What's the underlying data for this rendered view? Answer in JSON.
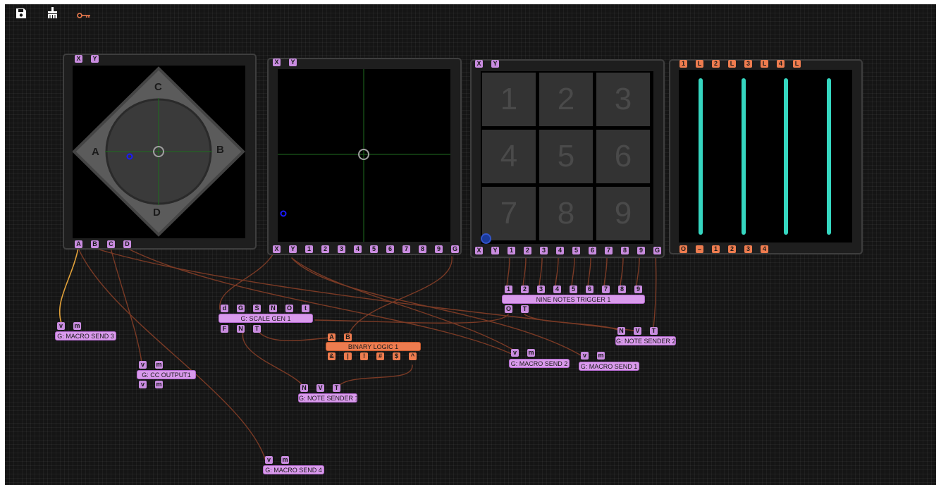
{
  "toolbar": {
    "save_icon": "save-icon",
    "clear_icon": "broom-icon",
    "key_icon": "key-icon",
    "key_color": "#ee7c4f"
  },
  "colors": {
    "port_purple": "#c98ce0",
    "port_orange": "#ee7c4f",
    "wire": "#7a3a25",
    "wire_active": "#e3a23a",
    "slider_cyan": "#35d6c0",
    "cursor_blue": "#1a1aff"
  },
  "panel1": {
    "top_ports": [
      "X",
      "Y"
    ],
    "labels": {
      "top": "C",
      "left": "A",
      "right": "B",
      "bottom": "D"
    },
    "bottom_ports": [
      "A",
      "B",
      "C",
      "D"
    ]
  },
  "panel2": {
    "top_ports": [
      "X",
      "Y"
    ],
    "bottom_ports": [
      "X",
      "Y",
      "1",
      "2",
      "3",
      "4",
      "5",
      "6",
      "7",
      "8",
      "9",
      "G"
    ]
  },
  "panel3": {
    "top_ports": [
      "X",
      "Y"
    ],
    "pads": [
      "1",
      "2",
      "3",
      "4",
      "5",
      "6",
      "7",
      "8",
      "9"
    ],
    "bottom_ports": [
      "X",
      "Y",
      "1",
      "2",
      "3",
      "4",
      "5",
      "6",
      "7",
      "8",
      "9",
      "G"
    ]
  },
  "panel4": {
    "top_ports": [
      "1",
      "L",
      "2",
      "L",
      "3",
      "L",
      "4",
      "L"
    ],
    "slider_count": 4,
    "bottom_ports": [
      "O",
      "–",
      "1",
      "2",
      "3",
      "4"
    ]
  },
  "nodes": {
    "macro_send_3": {
      "inputs": [
        "v",
        "m"
      ],
      "label": "G: MACRO SEND 3"
    },
    "cc_output1": {
      "inputs": [
        "v",
        "m"
      ],
      "label": "G: CC OUTPUT1",
      "outputs": [
        "v",
        "m"
      ]
    },
    "scale_gen_1": {
      "inputs": [
        "d",
        "G",
        "S",
        "N",
        "O",
        "t"
      ],
      "label": "G: SCALE GEN 1",
      "outputs": [
        "F",
        "N",
        "T"
      ]
    },
    "binary_logic_1": {
      "inputs": [
        "A",
        "B"
      ],
      "label": "BINARY LOGIC 1",
      "outputs": [
        "&",
        "|",
        "!",
        "#",
        "$",
        "^"
      ]
    },
    "note_sender_1": {
      "inputs": [
        "N",
        "V",
        "T"
      ],
      "label": "G: NOTE SENDER 1"
    },
    "macro_send_4": {
      "inputs": [
        "v",
        "m"
      ],
      "label": "G: MACRO SEND 4"
    },
    "nine_notes_trigger_1": {
      "inputs": [
        "1",
        "2",
        "3",
        "4",
        "5",
        "6",
        "7",
        "8",
        "9"
      ],
      "label": "NINE NOTES TRIGGER 1",
      "outputs": [
        "O",
        "T"
      ]
    },
    "note_sender_2": {
      "inputs": [
        "N",
        "V",
        "T"
      ],
      "label": "G: NOTE SENDER 2"
    },
    "macro_send_2": {
      "inputs": [
        "v",
        "m"
      ],
      "label": "G: MACRO SEND 2"
    },
    "macro_send_1": {
      "inputs": [
        "v",
        "m"
      ],
      "label": "G: MACRO SEND 1"
    }
  }
}
